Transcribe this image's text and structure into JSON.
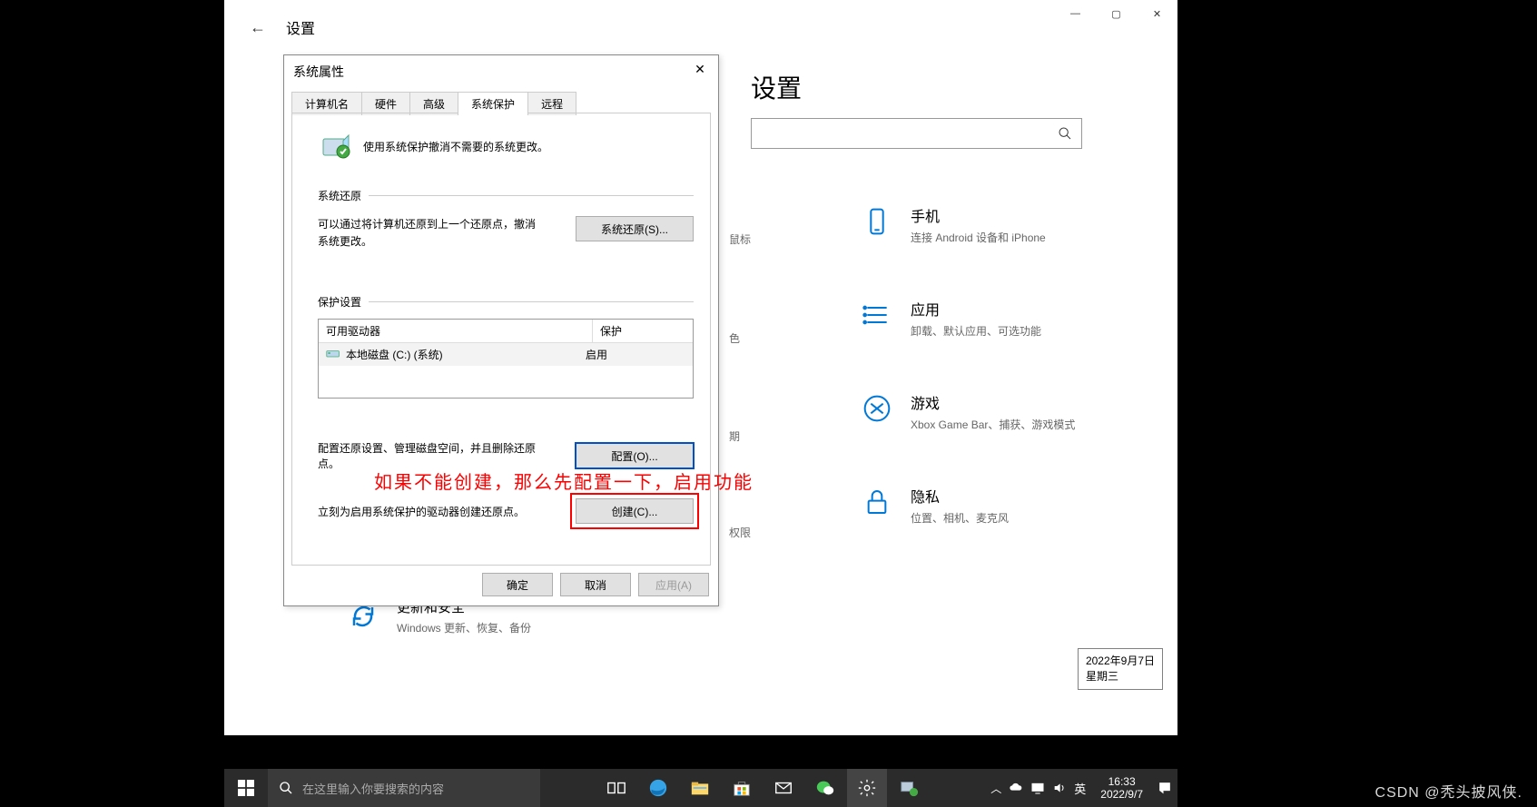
{
  "settings_window": {
    "title": "设置",
    "big_heading_suffix": "设置",
    "search_placeholder": "",
    "partial_fragments": {
      "frag1": "鼠标",
      "frag2": "色",
      "frag3": "期",
      "frag4": "权限"
    },
    "win_controls": {
      "min": "—",
      "max": "▢",
      "close": "✕"
    }
  },
  "settings_items": {
    "phone": {
      "label": "手机",
      "sub": "连接 Android 设备和 iPhone"
    },
    "apps": {
      "label": "应用",
      "sub": "卸载、默认应用、可选功能"
    },
    "gaming": {
      "label": "游戏",
      "sub": "Xbox Game Bar、捕获、游戏模式"
    },
    "privacy": {
      "label": "隐私",
      "sub": "位置、相机、麦克风"
    },
    "update": {
      "label": "更新和安全",
      "sub": "Windows 更新、恢复、备份"
    }
  },
  "dialog": {
    "title": "系统属性",
    "tabs": {
      "t1": "计算机名",
      "t2": "硬件",
      "t3": "高级",
      "t4": "系统保护",
      "t5": "远程"
    },
    "intro": "使用系统保护撤消不需要的系统更改。",
    "restore": {
      "heading": "系统还原",
      "desc": "可以通过将计算机还原到上一个还原点，撤消系统更改。",
      "button": "系统还原(S)..."
    },
    "protect": {
      "heading": "保护设置",
      "col_drive": "可用驱动器",
      "col_status": "保护",
      "drive_name": "本地磁盘 (C:) (系统)",
      "drive_status": "启用",
      "annotation": "如果不能创建，那么先配置一下，启用功能",
      "cfg_desc": "配置还原设置、管理磁盘空间，并且删除还原点。",
      "cfg_btn": "配置(O)...",
      "create_desc": "立刻为启用系统保护的驱动器创建还原点。",
      "create_btn": "创建(C)..."
    },
    "footer": {
      "ok": "确定",
      "cancel": "取消",
      "apply": "应用(A)"
    }
  },
  "date_tooltip": {
    "line1": "2022年9月7日",
    "line2": "星期三"
  },
  "taskbar": {
    "search_placeholder": "在这里输入你要搜索的内容",
    "ime": "英",
    "time": "16:33",
    "date": "2022/9/7"
  },
  "watermark": "CSDN @秃头披风侠."
}
